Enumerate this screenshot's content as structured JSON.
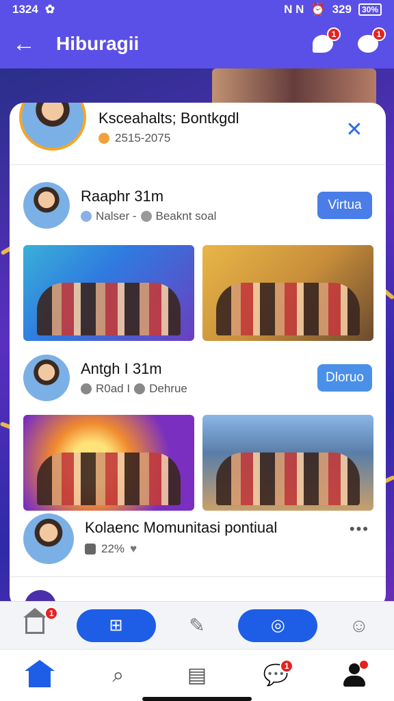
{
  "status_bar": {
    "time": "1324",
    "right_text": "N N",
    "signal": "329",
    "battery": "30%"
  },
  "header": {
    "title": "Hiburagii",
    "chat_badge": "1",
    "notif_badge": "1"
  },
  "top_post": {
    "name": "Ksceahalts; Bontkgdl",
    "meta": "2515-2075"
  },
  "posts": [
    {
      "name": "Raaphr 31m",
      "meta_a": "Nalser -",
      "meta_b": "Beaknt soal",
      "button": "Virtua"
    },
    {
      "name": "Antgh I 31m",
      "meta_a": "R0ad I",
      "meta_b": "Dehrue",
      "button": "Dloruo"
    }
  ],
  "komunitas": {
    "name": "Kolaenc Momunitasi pontiual",
    "meta": "22%",
    "more": "•••"
  },
  "actionbar": {
    "home_badge": "1",
    "add_glyph": "⊞",
    "brush_glyph": "✎",
    "target_glyph": "◎",
    "emoji_glyph": "☺"
  },
  "tabbar": {
    "search_glyph": "⌕",
    "db_glyph": "▤",
    "chat_badge": "1"
  },
  "colors": {
    "primary": "#5a4fe6",
    "accent_blue": "#1e5ee6",
    "badge_red": "#e52222"
  }
}
